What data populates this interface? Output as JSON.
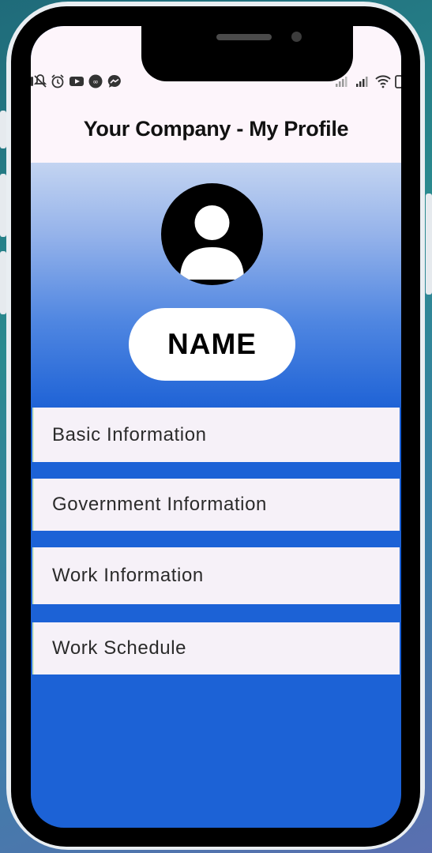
{
  "app": {
    "title": "Your Company - My Profile"
  },
  "status_bar": {
    "left_icons": [
      "mute-bell-icon",
      "alarm-icon",
      "youtube-icon",
      "app-icon",
      "messenger-icon"
    ],
    "right_icons": [
      "signal-icon",
      "signal-icon",
      "wifi-icon",
      "battery-icon"
    ]
  },
  "profile": {
    "avatar_icon": "person-icon",
    "name": "NAME"
  },
  "menu": {
    "items": [
      {
        "label": "Basic Information"
      },
      {
        "label": "Government Information"
      },
      {
        "label": "Work Information"
      },
      {
        "label": "Work Schedule"
      }
    ]
  },
  "colors": {
    "screen_background": "#1c62d6",
    "app_bar_background": "#fdf5fb",
    "card_background": "#f6f1f8",
    "pill_background": "#ffffff"
  }
}
